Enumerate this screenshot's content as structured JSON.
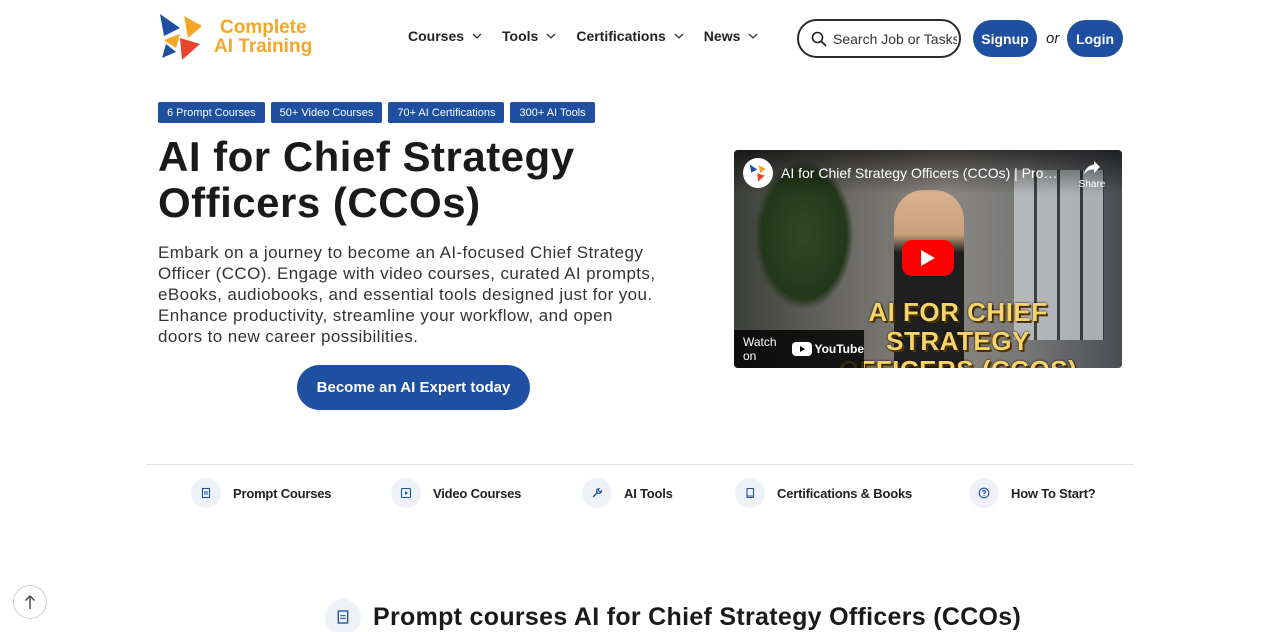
{
  "header": {
    "logo": {
      "line1": "Complete",
      "line2": "AI Training"
    },
    "nav": [
      {
        "label": "Courses"
      },
      {
        "label": "Tools"
      },
      {
        "label": "Certifications"
      },
      {
        "label": "News"
      }
    ],
    "search": {
      "placeholder": "Search Job or Tasks"
    },
    "signup_label": "Signup",
    "or_label": "or",
    "login_label": "Login"
  },
  "tags": [
    "6 Prompt Courses",
    "50+ Video Courses",
    "70+ AI Certifications",
    "300+ AI Tools"
  ],
  "hero": {
    "title": "AI for Chief Strategy Officers (CCOs)",
    "description": "Embark on a journey to become an AI-focused Chief Strategy Officer (CCO). Engage with video courses, curated AI prompts, eBooks, audiobooks, and essential tools designed just for you. Enhance productivity, streamline your workflow, and open doors to new career possibilities.",
    "cta_label": "Become an AI Expert today"
  },
  "video": {
    "title": "AI for Chief Strategy Officers (CCOs) | Prompt...",
    "share_label": "Share",
    "overlay_line1": "AI FOR CHIEF STRATEGY",
    "overlay_line2": "OFFICERS (CCOS)",
    "watch_on_label": "Watch on",
    "youtube_label": "YouTube"
  },
  "quick_links": [
    {
      "label": "Prompt Courses",
      "icon": "document-icon"
    },
    {
      "label": "Video Courses",
      "icon": "play-icon"
    },
    {
      "label": "AI Tools",
      "icon": "wrench-icon"
    },
    {
      "label": "Certifications & Books",
      "icon": "book-icon"
    },
    {
      "label": "How To Start?",
      "icon": "question-icon"
    }
  ],
  "section": {
    "heading": "Prompt courses AI for Chief Strategy Officers (CCOs)"
  },
  "colors": {
    "brand_blue": "#1e4fa1",
    "logo_orange": "#f5a623"
  }
}
